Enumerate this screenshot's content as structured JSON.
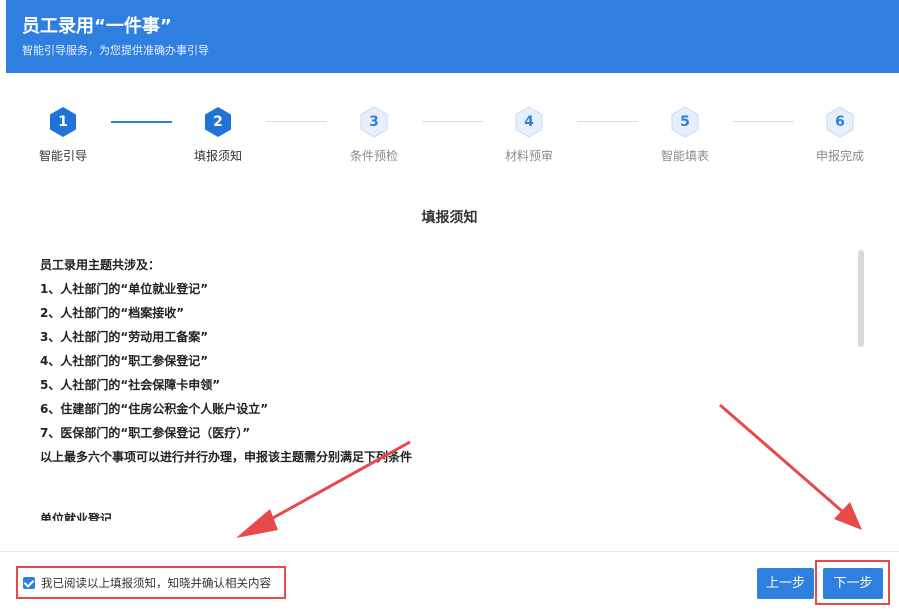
{
  "header": {
    "title": "员工录用“一件事”",
    "subtitle": "智能引导服务，为您提供准确办事引导"
  },
  "steps": [
    {
      "num": "1",
      "label": "智能引导",
      "state": "active"
    },
    {
      "num": "2",
      "label": "填报须知",
      "state": "active"
    },
    {
      "num": "3",
      "label": "条件预检",
      "state": "inactive"
    },
    {
      "num": "4",
      "label": "材料预审",
      "state": "inactive"
    },
    {
      "num": "5",
      "label": "智能填表",
      "state": "inactive"
    },
    {
      "num": "6",
      "label": "申报完成",
      "state": "inactive"
    }
  ],
  "notice": {
    "title": "填报须知",
    "lines": [
      "员工录用主题共涉及：",
      "1、人社部门的“单位就业登记”",
      "2、人社部门的“档案接收”",
      "3、人社部门的“劳动用工备案”",
      "4、人社部门的“职工参保登记”",
      "5、人社部门的“社会保障卡申领”",
      "6、住建部门的“住房公积金个人账户设立”",
      "7、医保部门的“职工参保登记（医疗）”",
      "以上最多六个事项可以进行并行办理，申报该主题需分别满足下列条件"
    ],
    "cut_line": "单位就业登记"
  },
  "footer": {
    "agree_text": "我已阅读以上填报须知，知晓并确认相关内容",
    "agree_checked": true,
    "prev_label": "上一步",
    "next_label": "下一步"
  },
  "colors": {
    "primary": "#2f7fe0",
    "annotation_red": "#e84a4a"
  }
}
